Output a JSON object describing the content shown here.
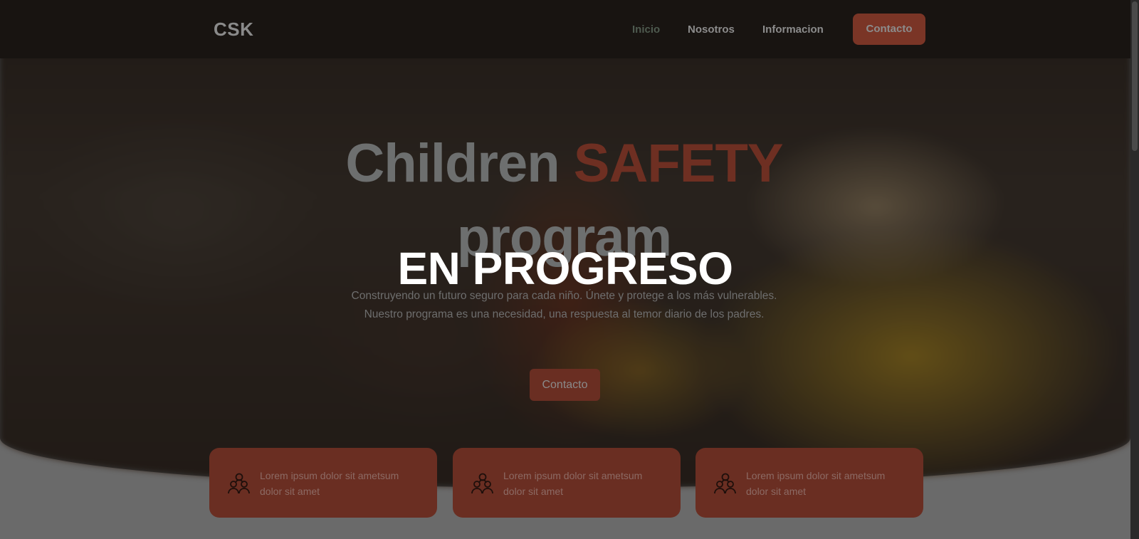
{
  "navbar": {
    "brand": "CSK",
    "links": [
      {
        "label": "Inicio",
        "active": true
      },
      {
        "label": "Nosotros",
        "active": false
      },
      {
        "label": "Informacion",
        "active": false
      }
    ],
    "contact_label": "Contacto"
  },
  "hero": {
    "title_part1": "Children",
    "title_accent": "SAFETY",
    "title_part2": "program",
    "subtitle": "Construyendo un futuro seguro para cada niño. Únete y protege a los más vulnerables. Nuestro programa es una necesidad, una respuesta al temor diario de los padres.",
    "button_label": "Contacto"
  },
  "overlay_label": "EN PROGRESO",
  "cards": [
    {
      "text": "Lorem ipsum dolor sit ametsum dolor sit amet",
      "icon": "users-icon"
    },
    {
      "text": "Lorem ipsum dolor sit ametsum dolor sit amet",
      "icon": "users-icon"
    },
    {
      "text": "Lorem ipsum dolor sit ametsum dolor sit amet",
      "icon": "users-icon"
    }
  ],
  "colors": {
    "accent": "#7a3526",
    "navbar": "#181411"
  }
}
